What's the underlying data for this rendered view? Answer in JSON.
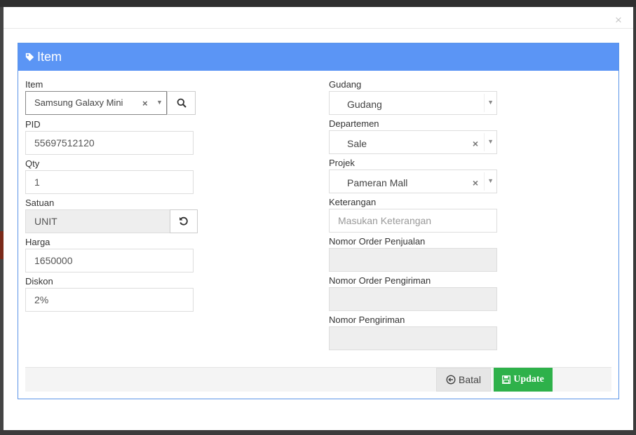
{
  "panel": {
    "title": "Item",
    "icon": "tag-icon"
  },
  "left": {
    "item": {
      "label": "Item",
      "value": "Samsung Galaxy Mini",
      "clear": "×",
      "arrow": "▼"
    },
    "pid": {
      "label": "PID",
      "value": "55697512120"
    },
    "qty": {
      "label": "Qty",
      "value": "1"
    },
    "satuan": {
      "label": "Satuan",
      "value": "UNIT"
    },
    "harga": {
      "label": "Harga",
      "value": "1650000"
    },
    "diskon": {
      "label": "Diskon",
      "value": "2%"
    }
  },
  "right": {
    "gudang": {
      "label": "Gudang",
      "value": "Gudang",
      "arrow": "▼"
    },
    "departemen": {
      "label": "Departemen",
      "value": "Sale",
      "clear": "×",
      "arrow": "▼"
    },
    "projek": {
      "label": "Projek",
      "value": "Pameran Mall",
      "clear": "×",
      "arrow": "▼"
    },
    "keterangan": {
      "label": "Keterangan",
      "placeholder": "Masukan Keterangan"
    },
    "nomor_order_penjualan": {
      "label": "Nomor Order Penjualan",
      "value": ""
    },
    "nomor_order_pengiriman": {
      "label": "Nomor Order Pengiriman",
      "value": ""
    },
    "nomor_pengiriman": {
      "label": "Nomor Pengiriman",
      "value": ""
    }
  },
  "footer": {
    "batal_label": "Batal",
    "update_label": "Update"
  },
  "modal": {
    "close": "×"
  },
  "colors": {
    "primary": "#5b95f5",
    "success": "#2eb14a",
    "readonly": "#eeeeee"
  }
}
